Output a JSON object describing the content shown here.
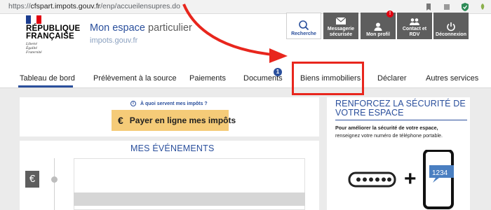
{
  "browser": {
    "url_prefix": "https://",
    "url_domain": "cfspart.impots.gouv.fr",
    "url_path": "/enp/accueilensupres.do"
  },
  "header": {
    "republic_title": "RÉPUBLIQUE\nFRANÇAISE",
    "republic_motto": "Liberté\nÉgalité\nFraternité",
    "space_title_main": "Mon espace",
    "space_title_light": " particulier",
    "space_subtitle": "impots.gouv.fr",
    "buttons": {
      "search": "Recherche",
      "messaging": "Messagerie sécurisée",
      "profile": "Mon profil",
      "profile_badge": "!",
      "contact": "Contact et RDV",
      "logout": "Déconnexion"
    }
  },
  "nav": {
    "items": [
      "Tableau de bord",
      "Prélèvement à la source",
      "Paiements",
      "Documents",
      "Biens immobiliers",
      "Déclarer",
      "Autres services"
    ],
    "documents_badge": "1"
  },
  "main": {
    "info_link": "À quoi servent mes impôts ?",
    "info_icon": "i",
    "pay_symbol": "€",
    "pay_button": "Payer en ligne mes impôts",
    "events_title": "MES ÉVÉNEMENTS",
    "event_icon": "€"
  },
  "sidebar": {
    "title": "RENFORCEZ LA SÉCURITÉ DE VOTRE ESPACE",
    "text_bold": "Pour améliorer la sécurité de votre espace,",
    "text_normal": "renseignez votre numéro de téléphone portable.",
    "plus": "+",
    "phone_code": "1234"
  },
  "colors": {
    "brand_blue": "#2a4f9c",
    "annotation_red": "#e8261d",
    "pay_yellow": "#f5cb78",
    "button_grey": "#5e5e5e"
  }
}
